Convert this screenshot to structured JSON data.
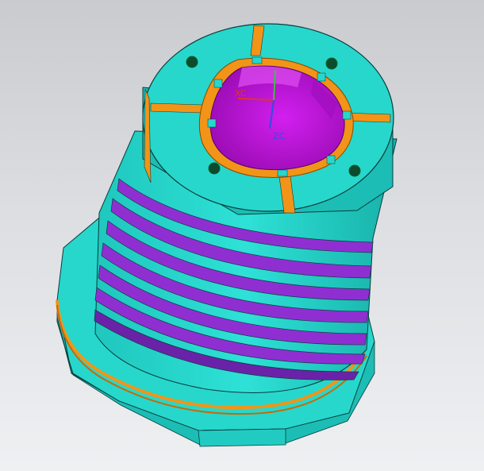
{
  "viewport": {
    "background_top": "#c9cbcf",
    "background_bottom": "#eef0f2"
  },
  "model": {
    "colors": {
      "body": "#27d7cc",
      "body_shade": "#16a8a1",
      "body_dark": "#0e7f7a",
      "groove": "#8f2fd2",
      "groove_dark": "#5f1c98",
      "slot": "#f29418",
      "slot_dark": "#c76a06",
      "bore": "#c417e0",
      "bore_dark": "#8d0aa6",
      "edge": "#0a3c3c"
    },
    "mounting_holes": 4,
    "slots": 4,
    "grooves": 7
  },
  "wcs": {
    "x_label": "XC",
    "z_label": "ZC",
    "x_color": "#e0361f",
    "y_color": "#3cc23c",
    "z_color": "#2d4fe0"
  }
}
